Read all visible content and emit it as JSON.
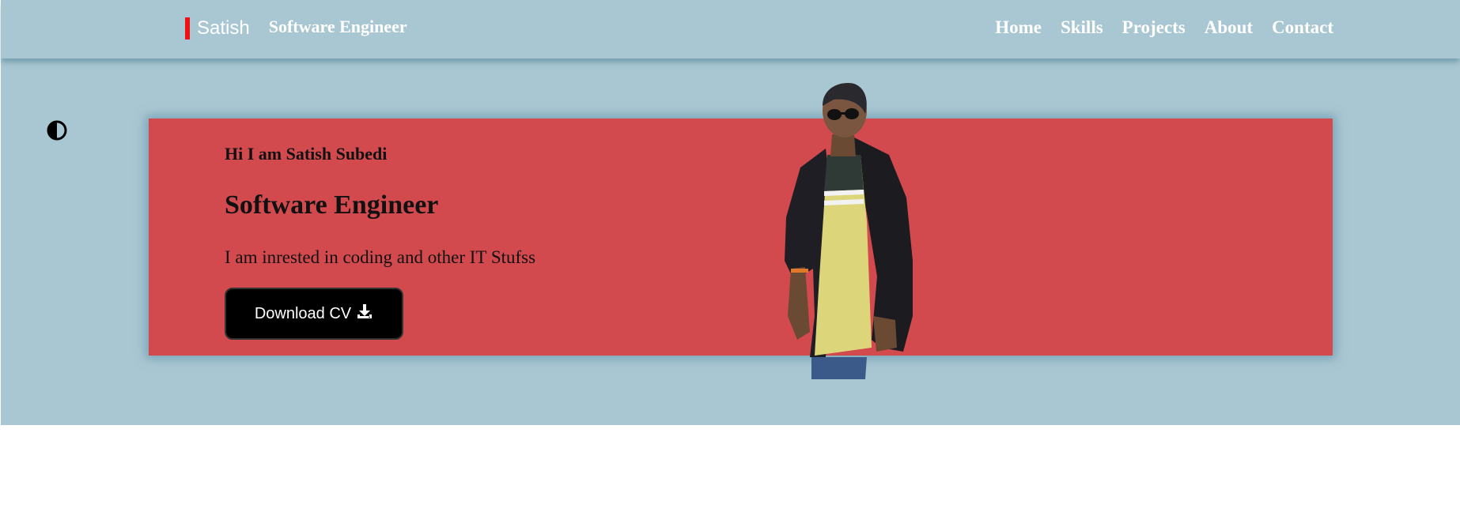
{
  "brand": {
    "name": "Satish",
    "role": "Software Engineer"
  },
  "nav": {
    "items": [
      {
        "label": "Home"
      },
      {
        "label": "Skills"
      },
      {
        "label": "Projects"
      },
      {
        "label": "About"
      },
      {
        "label": "Contact"
      }
    ]
  },
  "hero": {
    "greeting": "Hi I am Satish Subedi",
    "title": "Software Engineer",
    "intro": "I am inrested in coding and other IT Stufss",
    "download_label": "Download CV"
  },
  "icons": {
    "theme_toggle": "contrast-icon",
    "download": "download-icon"
  },
  "colors": {
    "background": "#a9c7d2",
    "card": "#d24a4e",
    "brand_accent": "#ee1111",
    "button": "#000000",
    "text_light": "#ffffff",
    "text_dark": "#111111"
  }
}
